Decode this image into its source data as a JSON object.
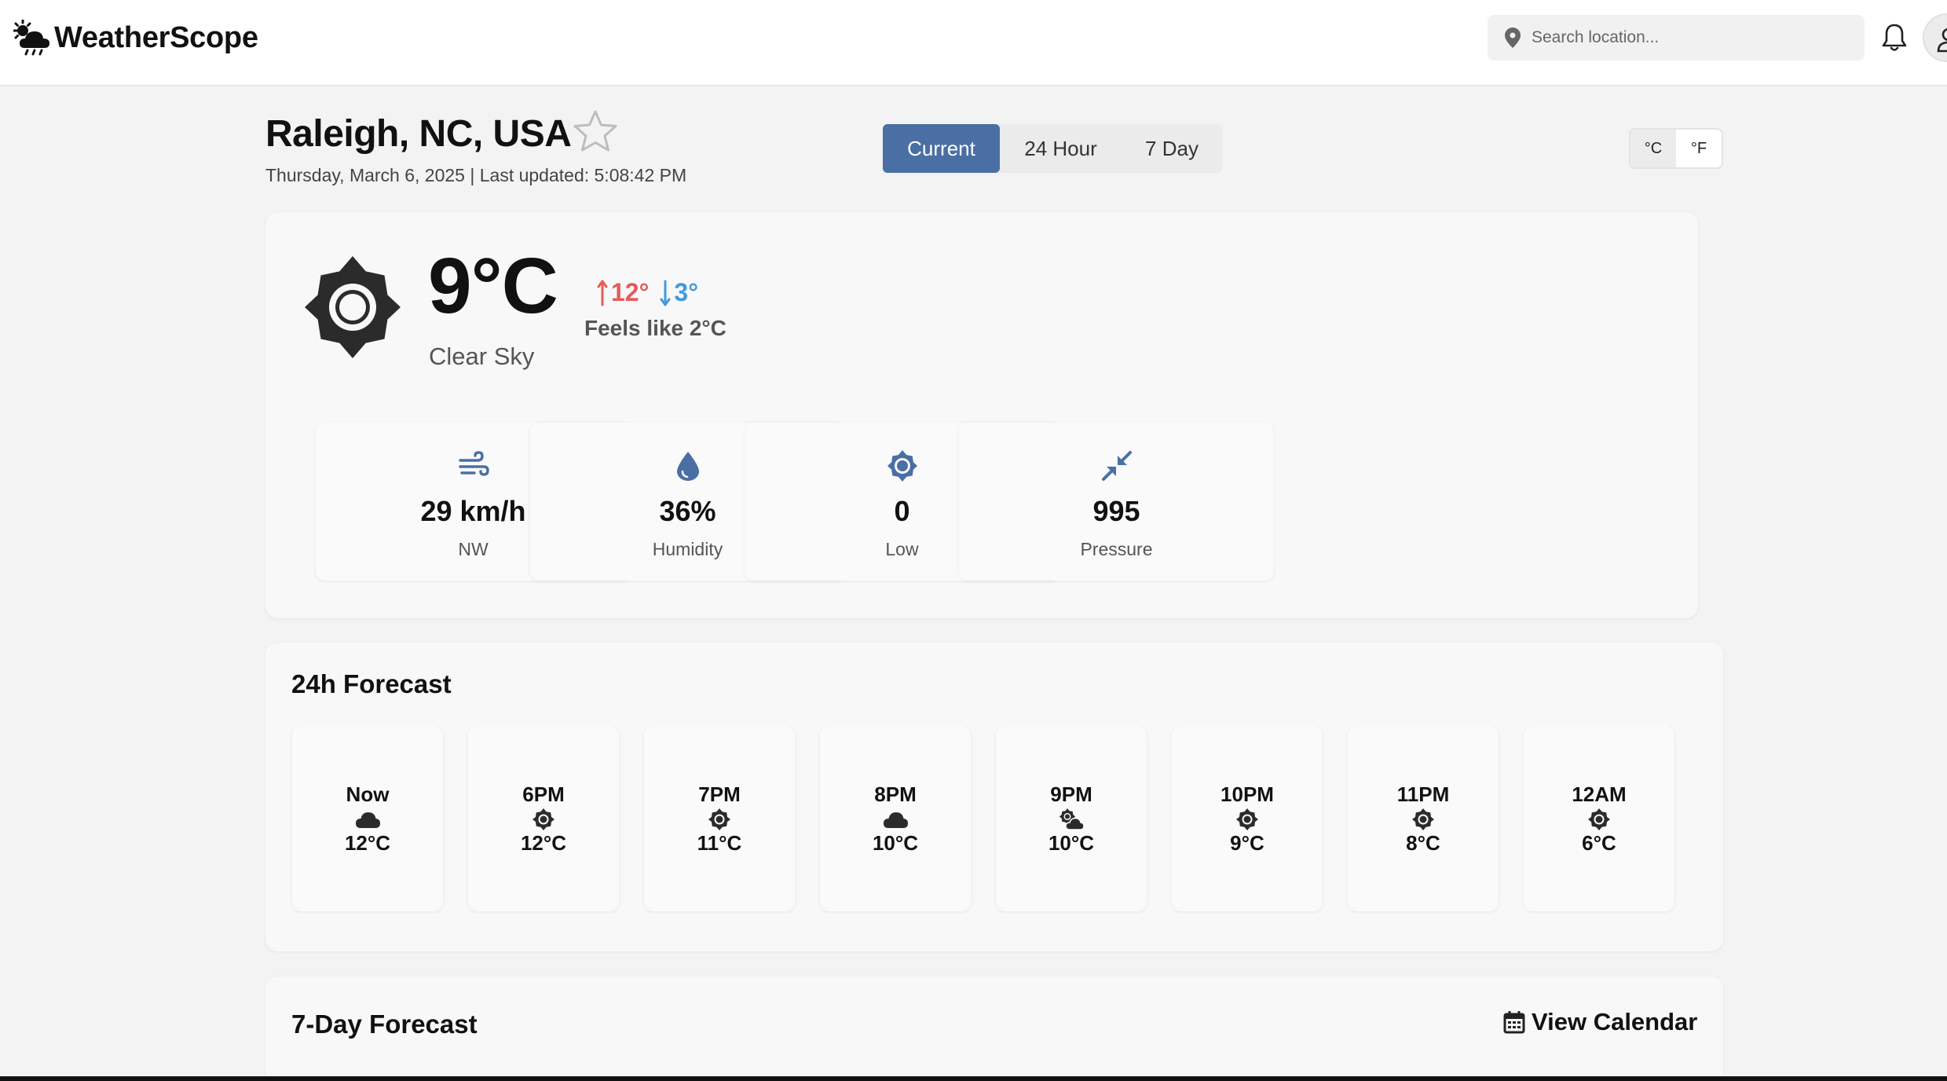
{
  "app": {
    "name": "WeatherScope"
  },
  "search": {
    "placeholder": "Search location..."
  },
  "location": {
    "name": "Raleigh, NC, USA",
    "date_line": "Thursday, March 6, 2025 | Last updated: 5:08:42 PM"
  },
  "tabs": [
    {
      "label": "Current",
      "active": true
    },
    {
      "label": "24 Hour",
      "active": false
    },
    {
      "label": "7 Day",
      "active": false
    }
  ],
  "units": [
    {
      "label": "°C",
      "active": true
    },
    {
      "label": "°F",
      "active": false
    }
  ],
  "current": {
    "temp": "9°C",
    "condition": "Clear Sky",
    "high": "12°",
    "low": "3°",
    "feels_like": "Feels like 2°C",
    "icon": "sun-icon"
  },
  "stats": [
    {
      "value": "29 km/h",
      "label": "NW",
      "icon": "wind-icon"
    },
    {
      "value": "36%",
      "label": "Humidity",
      "icon": "droplet-icon"
    },
    {
      "value": "0",
      "label": "Low",
      "icon": "uv-sun-icon"
    },
    {
      "value": "995",
      "label": "Pressure",
      "icon": "compress-arrows-icon"
    }
  ],
  "forecast24": {
    "title": "24h Forecast",
    "hours": [
      {
        "time": "Now",
        "temp": "12°C",
        "icon": "cloud-icon"
      },
      {
        "time": "6PM",
        "temp": "12°C",
        "icon": "sun-icon"
      },
      {
        "time": "7PM",
        "temp": "11°C",
        "icon": "sun-icon"
      },
      {
        "time": "8PM",
        "temp": "10°C",
        "icon": "cloud-icon"
      },
      {
        "time": "9PM",
        "temp": "10°C",
        "icon": "partly-cloudy-icon"
      },
      {
        "time": "10PM",
        "temp": "9°C",
        "icon": "sun-icon"
      },
      {
        "time": "11PM",
        "temp": "8°C",
        "icon": "sun-icon"
      },
      {
        "time": "12AM",
        "temp": "6°C",
        "icon": "sun-icon"
      }
    ]
  },
  "forecast7": {
    "title": "7-Day Forecast",
    "calendar_label": "View Calendar"
  },
  "colors": {
    "accent": "#4a6fa5",
    "high": "#e45b5b",
    "low": "#3f9ae0",
    "icon_blue": "#4a6fa5"
  }
}
